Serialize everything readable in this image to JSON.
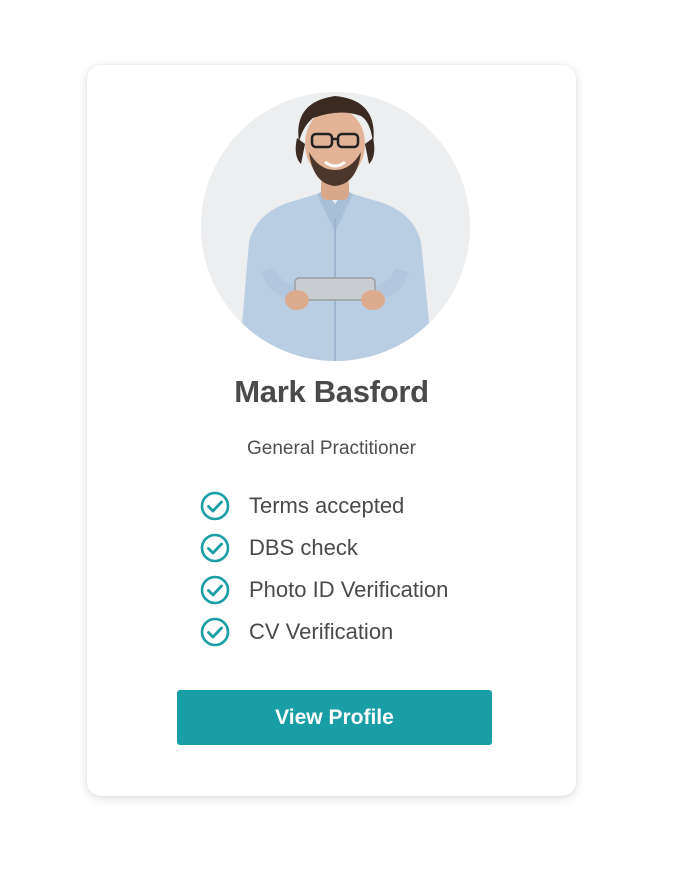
{
  "profile": {
    "name": "Mark Basford",
    "role": "General Practitioner",
    "avatar_alt": "profile photo"
  },
  "checks": [
    {
      "label": "Terms accepted",
      "icon": "check-circle-icon",
      "status": "complete"
    },
    {
      "label": "DBS check",
      "icon": "check-circle-icon",
      "status": "complete"
    },
    {
      "label": "Photo ID Verification",
      "icon": "check-circle-icon",
      "status": "complete"
    },
    {
      "label": "CV Verification",
      "icon": "check-circle-icon",
      "status": "complete"
    }
  ],
  "actions": {
    "view_profile_label": "View Profile"
  },
  "colors": {
    "accent": "#1a9ea6",
    "text": "#4a4a4a",
    "card_background": "#ffffff"
  }
}
